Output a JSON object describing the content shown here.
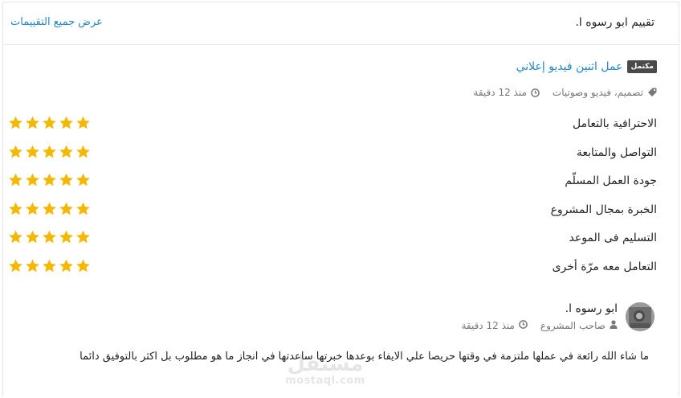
{
  "header": {
    "title": "تقييم ابو رسوه ا.",
    "view_all_label": "عرض جميع التقييمات"
  },
  "project": {
    "badge": "مكتمل",
    "title": "عمل اثنين فيديو إعلاني",
    "category": "تصميم، فيديو وصوتيات",
    "time": "منذ 12 دقيقة"
  },
  "criteria": [
    {
      "label": "الاحترافية بالتعامل",
      "rating": 5
    },
    {
      "label": "التواصل والمتابعة",
      "rating": 5
    },
    {
      "label": "جودة العمل المسلّم",
      "rating": 5
    },
    {
      "label": "الخبرة بمجال المشروع",
      "rating": 5
    },
    {
      "label": "التسليم فى الموعد",
      "rating": 5
    },
    {
      "label": "التعامل معه مرّة أخرى",
      "rating": 5
    }
  ],
  "reviewer": {
    "name": "ابو رسوه ا.",
    "role": "صاحب المشروع",
    "time": "منذ 12 دقيقة"
  },
  "comment": "ما شاء الله رائعة في عملها ملتزمة في وقتها حريصا علي الايفاء بوعدها خبرتها ساعدتها في انجاز ما هو مطلوب بل اكثر بالتوفيق دائما",
  "watermark": {
    "arabic": "مستقل",
    "latin": "mostaql.com"
  },
  "colors": {
    "star": "#f5b800",
    "link": "#2386c8",
    "badge": "#4a4a4a"
  },
  "icons": {
    "tag": "tag-icon",
    "clock": "clock-icon",
    "user": "user-icon",
    "star": "star-icon"
  }
}
